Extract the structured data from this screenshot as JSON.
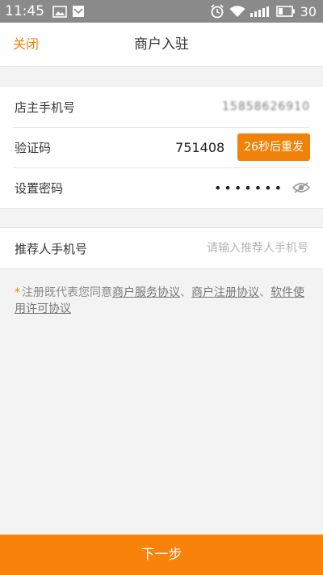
{
  "status_bar": {
    "time": "11:45",
    "battery_level": "30",
    "icons": [
      "image-icon",
      "mail-icon",
      "alarm-icon",
      "wifi-icon",
      "signal-icon",
      "battery-icon"
    ]
  },
  "header": {
    "close_label": "关闭",
    "title": "商户入驻"
  },
  "form": {
    "owner_phone": {
      "label": "店主手机号",
      "value": "15858626910"
    },
    "verification": {
      "label": "验证码",
      "value": "751408",
      "resend_label": "26秒后重发"
    },
    "password": {
      "label": "设置密码",
      "masked_value": "•••••••"
    },
    "referrer": {
      "label": "推荐人手机号",
      "placeholder": "请输入推荐人手机号"
    }
  },
  "agreement": {
    "star": "*",
    "text_prefix": "注册既代表您同意",
    "links": [
      "商户服务协议",
      "商户注册协议",
      "软件使用许可协议"
    ],
    "separator": "、"
  },
  "footer": {
    "next_label": "下一步"
  },
  "colors": {
    "accent": "#f0820a",
    "status_bar": "#8a8a8a"
  }
}
